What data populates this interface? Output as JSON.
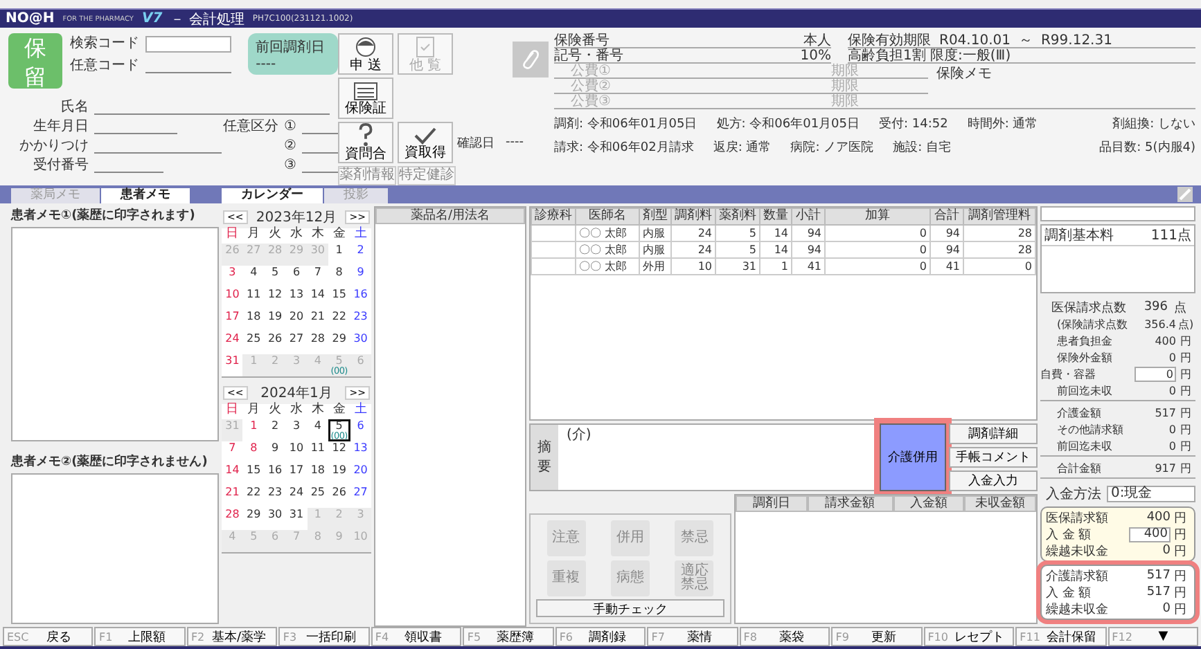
{
  "title": {
    "logo": "NO@H",
    "tagline": "FOR THE PHARMACY",
    "version": "V7",
    "name": "－ 会計処理",
    "build": "PH7C100(231121.1002)"
  },
  "hold_button": "保留",
  "patient": {
    "search_code": "検索コード",
    "any_code": "任意コード",
    "name": "氏名",
    "birth": "生年月日",
    "family": "かかりつけ",
    "reception": "受付番号"
  },
  "optional_category": {
    "label": "任意区分",
    "slots": [
      "①",
      "②",
      "③"
    ]
  },
  "last_dispensed": {
    "label": "前回調剤日",
    "value": "----"
  },
  "tool_buttons": [
    {
      "label": "申 送",
      "kind": "face",
      "disabled": false
    },
    {
      "label": "他 覧",
      "kind": "checklist",
      "disabled": true
    },
    {
      "label": "保険証",
      "kind": "card",
      "disabled": false
    },
    {
      "label": "資問合",
      "kind": "question",
      "disabled": false
    },
    {
      "label": "資取得",
      "kind": "check",
      "disabled": false
    }
  ],
  "confirm_date": {
    "label": "確認日",
    "value": "----"
  },
  "small_buttons": [
    {
      "label": "薬剤情報",
      "disabled": true
    },
    {
      "label": "特定健診",
      "disabled": true
    }
  ],
  "insurance": {
    "number_label": "保険番号",
    "relation": "本人",
    "symbol_label": "記号・番号",
    "rate": "10%",
    "public": [
      {
        "label": "公費①",
        "limit": "期限"
      },
      {
        "label": "公費②",
        "limit": "期限"
      },
      {
        "label": "公費③",
        "limit": "期限"
      }
    ],
    "valid_label": "保険有効期限",
    "valid_from": "R04.10.01",
    "valid_sep": "～",
    "valid_to": "R99.12.31",
    "elderly": "高齢負担1割 限度:一般(Ⅲ)",
    "memo_label": "保険メモ"
  },
  "info_lines": [
    [
      "調剤: 令和06年01月05日",
      "処方: 令和06年01月05日",
      "受付: 14:52",
      "時間外: 通常",
      "剤組換: しない"
    ],
    [
      "請求: 令和06年02月請求",
      "返戻: 通常",
      "病院: ノア医院",
      "施設: 自宅",
      "品目数: 5(内服4)"
    ]
  ],
  "memo_tabs": [
    {
      "label": "薬局メモ",
      "selected": false
    },
    {
      "label": "患者メモ",
      "selected": true
    }
  ],
  "memos": [
    "患者メモ①(薬歴に印字されます)",
    "患者メモ②(薬歴に印字されません)"
  ],
  "calendar_tabs": [
    {
      "label": "カレンダー",
      "selected": true
    },
    {
      "label": "投影",
      "selected": false
    }
  ],
  "calendars": [
    {
      "prev": "<<",
      "title": "2023年12月",
      "next": ">>",
      "weekdays": [
        "日",
        "月",
        "火",
        "水",
        "木",
        "金",
        "土"
      ],
      "weeks": [
        [
          {
            "d": "26",
            "other": true,
            "selected": false
          },
          {
            "d": "27",
            "other": true,
            "selected": false
          },
          {
            "d": "28",
            "other": true,
            "selected": false
          },
          {
            "d": "29",
            "other": true,
            "selected": false
          },
          {
            "d": "30",
            "other": true,
            "selected": false
          },
          {
            "d": "1",
            "other": false,
            "selected": false
          },
          {
            "d": "2",
            "other": false,
            "selected": false
          }
        ],
        [
          {
            "d": "3",
            "other": false,
            "selected": false
          },
          {
            "d": "4",
            "other": false,
            "selected": false
          },
          {
            "d": "5",
            "other": false,
            "selected": false
          },
          {
            "d": "6",
            "other": false,
            "selected": false
          },
          {
            "d": "7",
            "other": false,
            "selected": false
          },
          {
            "d": "8",
            "other": false,
            "selected": false
          },
          {
            "d": "9",
            "other": false,
            "selected": false
          }
        ],
        [
          {
            "d": "10",
            "other": false,
            "selected": false
          },
          {
            "d": "11",
            "other": false,
            "selected": false
          },
          {
            "d": "12",
            "other": false,
            "selected": false
          },
          {
            "d": "13",
            "other": false,
            "selected": false
          },
          {
            "d": "14",
            "other": false,
            "selected": false
          },
          {
            "d": "15",
            "other": false,
            "selected": false
          },
          {
            "d": "16",
            "other": false,
            "selected": false
          }
        ],
        [
          {
            "d": "17",
            "other": false,
            "selected": false
          },
          {
            "d": "18",
            "other": false,
            "selected": false
          },
          {
            "d": "19",
            "other": false,
            "selected": false
          },
          {
            "d": "20",
            "other": false,
            "selected": false
          },
          {
            "d": "21",
            "other": false,
            "selected": false
          },
          {
            "d": "22",
            "other": false,
            "selected": false
          },
          {
            "d": "23",
            "other": false,
            "selected": false
          }
        ],
        [
          {
            "d": "24",
            "other": false,
            "selected": false
          },
          {
            "d": "25",
            "other": false,
            "selected": false
          },
          {
            "d": "26",
            "other": false,
            "selected": false
          },
          {
            "d": "27",
            "other": false,
            "selected": false
          },
          {
            "d": "28",
            "other": false,
            "selected": false
          },
          {
            "d": "29",
            "other": false,
            "selected": false
          },
          {
            "d": "30",
            "other": false,
            "selected": false
          }
        ],
        [
          {
            "d": "31",
            "other": false,
            "selected": false
          },
          {
            "d": "1",
            "other": true,
            "selected": false
          },
          {
            "d": "2",
            "other": true,
            "selected": false
          },
          {
            "d": "3",
            "other": true,
            "selected": false
          },
          {
            "d": "4",
            "other": true,
            "selected": false
          },
          {
            "d": "5",
            "other": true,
            "selected": false,
            "note": "(00)"
          },
          {
            "d": "6",
            "other": true,
            "selected": false
          }
        ]
      ]
    },
    {
      "prev": "<<",
      "title": "2024年1月",
      "next": ">>",
      "weekdays": [
        "日",
        "月",
        "火",
        "水",
        "木",
        "金",
        "土"
      ],
      "weeks": [
        [
          {
            "d": "31",
            "other": true,
            "selected": false
          },
          {
            "d": "1",
            "other": false,
            "holiday": true,
            "selected": false
          },
          {
            "d": "2",
            "other": false,
            "selected": false
          },
          {
            "d": "3",
            "other": false,
            "selected": false
          },
          {
            "d": "4",
            "other": false,
            "selected": false
          },
          {
            "d": "5",
            "other": false,
            "selected": true,
            "note": "(00)"
          },
          {
            "d": "6",
            "other": false,
            "selected": false
          }
        ],
        [
          {
            "d": "7",
            "other": false,
            "selected": false
          },
          {
            "d": "8",
            "other": false,
            "holiday": true,
            "selected": false
          },
          {
            "d": "9",
            "other": false,
            "selected": false
          },
          {
            "d": "10",
            "other": false,
            "selected": false
          },
          {
            "d": "11",
            "other": false,
            "selected": false
          },
          {
            "d": "12",
            "other": false,
            "selected": false
          },
          {
            "d": "13",
            "other": false,
            "selected": false
          }
        ],
        [
          {
            "d": "14",
            "other": false,
            "selected": false
          },
          {
            "d": "15",
            "other": false,
            "selected": false
          },
          {
            "d": "16",
            "other": false,
            "selected": false
          },
          {
            "d": "17",
            "other": false,
            "selected": false
          },
          {
            "d": "18",
            "other": false,
            "selected": false
          },
          {
            "d": "19",
            "other": false,
            "selected": false
          },
          {
            "d": "20",
            "other": false,
            "selected": false
          }
        ],
        [
          {
            "d": "21",
            "other": false,
            "selected": false
          },
          {
            "d": "22",
            "other": false,
            "selected": false
          },
          {
            "d": "23",
            "other": false,
            "selected": false
          },
          {
            "d": "24",
            "other": false,
            "selected": false
          },
          {
            "d": "25",
            "other": false,
            "selected": false
          },
          {
            "d": "26",
            "other": false,
            "selected": false
          },
          {
            "d": "27",
            "other": false,
            "selected": false
          }
        ],
        [
          {
            "d": "28",
            "other": false,
            "selected": false
          },
          {
            "d": "29",
            "other": false,
            "selected": false
          },
          {
            "d": "30",
            "other": false,
            "selected": false
          },
          {
            "d": "31",
            "other": false,
            "selected": false
          },
          {
            "d": "1",
            "other": true,
            "selected": false
          },
          {
            "d": "2",
            "other": true,
            "selected": false
          },
          {
            "d": "3",
            "other": true,
            "selected": false
          }
        ],
        [
          {
            "d": "4",
            "other": true,
            "selected": false
          },
          {
            "d": "5",
            "other": true,
            "selected": false
          },
          {
            "d": "6",
            "other": true,
            "selected": false
          },
          {
            "d": "7",
            "other": true,
            "selected": false
          },
          {
            "d": "8",
            "other": true,
            "selected": false
          },
          {
            "d": "9",
            "other": true,
            "selected": false
          },
          {
            "d": "10",
            "other": true,
            "selected": false
          }
        ]
      ]
    }
  ],
  "drug_list": {
    "header": "薬品名/用法名"
  },
  "table": {
    "columns": [
      "診療科",
      "医師名",
      "剤型",
      "調剤料",
      "薬剤料",
      "数量",
      "小計",
      "加算",
      "合計",
      "調剤管理料"
    ],
    "rows": [
      [
        "",
        "〇〇 太郎",
        "内服",
        "24",
        "5",
        "14",
        "94",
        "0",
        "94",
        "28"
      ],
      [
        "",
        "〇〇 太郎",
        "内服",
        "24",
        "5",
        "14",
        "94",
        "0",
        "94",
        "28"
      ],
      [
        "",
        "〇〇 太郎",
        "外用",
        "10",
        "31",
        "1",
        "41",
        "0",
        "41",
        "0"
      ]
    ]
  },
  "summary_note": {
    "label": "摘要",
    "value": "(介)"
  },
  "care_button": {
    "label": "介護併用",
    "highlighted": true
  },
  "side_buttons": [
    "調剤詳細",
    "手帳コメント",
    "入金入力"
  ],
  "check_buttons": [
    {
      "label": "注意",
      "disabled": true
    },
    {
      "label": "併用",
      "disabled": true
    },
    {
      "label": "禁忌",
      "disabled": true
    },
    {
      "label": "重複",
      "disabled": true
    },
    {
      "label": "病態",
      "disabled": true
    },
    {
      "label": "適応禁忌",
      "disabled": true
    }
  ],
  "manual_check": "手動チェック",
  "history": {
    "columns": [
      "調剤日",
      "請求金額",
      "入金額",
      "未収金額"
    ]
  },
  "fee_list": [
    {
      "name": "調剤基本料",
      "value": "111点"
    }
  ],
  "summary_groups": [
    [
      {
        "kind": "main",
        "label": "医保請求点数",
        "value": "396",
        "unit": "点"
      },
      {
        "kind": "sub",
        "label": "(保険請求点数",
        "value": "356.4",
        "unit": "点)"
      },
      {
        "kind": "sub",
        "label": "患者負担金",
        "value": "400",
        "unit": "円"
      },
      {
        "kind": "sub",
        "label": "保険外金額",
        "value": "0",
        "unit": "円"
      },
      {
        "kind": "input",
        "label": "自費・容器",
        "value": "0",
        "unit": "円"
      },
      {
        "kind": "sub",
        "label": "前回迄未収",
        "value": "0",
        "unit": "円"
      }
    ],
    [
      {
        "kind": "sub",
        "label": "介護金額",
        "value": "517",
        "unit": "円"
      },
      {
        "kind": "sub",
        "label": "その他請求額",
        "value": "0",
        "unit": "円"
      },
      {
        "kind": "sub",
        "label": "前回迄未収",
        "value": "0",
        "unit": "円"
      }
    ],
    [
      {
        "kind": "sub",
        "label": "合計金額",
        "value": "917",
        "unit": "円"
      }
    ]
  ],
  "payment_method": {
    "label": "入金方法",
    "value": "0:現金"
  },
  "payment_boxes": [
    {
      "highlighted": false,
      "rows": [
        {
          "kind": "text",
          "label": "医保請求額",
          "value": "400",
          "unit": "円"
        },
        {
          "kind": "input",
          "label": "入 金 額",
          "value": "400",
          "unit": "円"
        },
        {
          "kind": "text",
          "label": "繰越未収金",
          "value": "0",
          "unit": "円"
        }
      ]
    },
    {
      "highlighted": true,
      "rows": [
        {
          "kind": "text",
          "label": "介護請求額",
          "value": "517",
          "unit": "円"
        },
        {
          "kind": "text",
          "label": "入 金 額",
          "value": "517",
          "unit": "円"
        },
        {
          "kind": "text",
          "label": "繰越未収金",
          "value": "0",
          "unit": "円"
        }
      ]
    }
  ],
  "function_keys": [
    {
      "key": "ESC",
      "label": "戻る"
    },
    {
      "key": "F1",
      "label": "上限額"
    },
    {
      "key": "F2",
      "label": "基本/薬学"
    },
    {
      "key": "F3",
      "label": "一括印刷"
    },
    {
      "key": "F4",
      "label": "領収書"
    },
    {
      "key": "F5",
      "label": "薬歴簿"
    },
    {
      "key": "F6",
      "label": "調剤録"
    },
    {
      "key": "F7",
      "label": "薬情"
    },
    {
      "key": "F8",
      "label": "薬袋"
    },
    {
      "key": "F9",
      "label": "更新"
    },
    {
      "key": "F10",
      "label": "レセプト"
    },
    {
      "key": "F11",
      "label": "会計保留"
    },
    {
      "key": "F12",
      "label": "▼"
    }
  ]
}
